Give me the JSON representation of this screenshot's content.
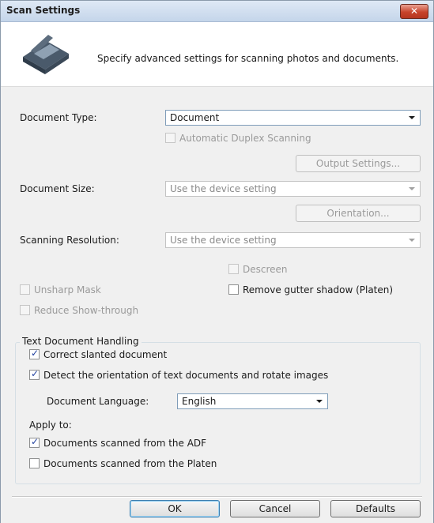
{
  "window": {
    "title": "Scan Settings",
    "close_label": "✕"
  },
  "header": {
    "text": "Specify advanced settings for scanning photos and documents."
  },
  "document_type": {
    "label": "Document Type:",
    "value": "Document"
  },
  "automatic_duplex": {
    "label": "Automatic Duplex Scanning",
    "checked": false,
    "enabled": false
  },
  "output_settings": {
    "label": "Output Settings..."
  },
  "document_size": {
    "label": "Document Size:",
    "value": "Use the device setting"
  },
  "orientation": {
    "label": "Orientation..."
  },
  "scanning_resolution": {
    "label": "Scanning Resolution:",
    "value": "Use the device setting"
  },
  "descreen": {
    "label": "Descreen",
    "checked": false,
    "enabled": false
  },
  "unsharp_mask": {
    "label": "Unsharp Mask",
    "checked": false,
    "enabled": false
  },
  "remove_gutter": {
    "label": "Remove gutter shadow (Platen)",
    "checked": false,
    "enabled": true
  },
  "reduce_show_through": {
    "label": "Reduce Show-through",
    "checked": false,
    "enabled": false
  },
  "text_handling": {
    "title": "Text Document Handling",
    "correct_slanted": {
      "label": "Correct slanted document",
      "checked": true
    },
    "detect_orientation": {
      "label": "Detect the orientation of text documents and rotate images",
      "checked": true
    },
    "language_label": "Document Language:",
    "language_value": "English",
    "apply_to_label": "Apply to:",
    "from_adf": {
      "label": "Documents scanned from the ADF",
      "checked": true
    },
    "from_platen": {
      "label": "Documents scanned from the Platen",
      "checked": false
    }
  },
  "buttons": {
    "ok": "OK",
    "cancel": "Cancel",
    "defaults": "Defaults"
  },
  "icons": {
    "scanner": "scanner-icon",
    "dropdown": "chevron-down-icon",
    "check": "checkmark-icon"
  }
}
